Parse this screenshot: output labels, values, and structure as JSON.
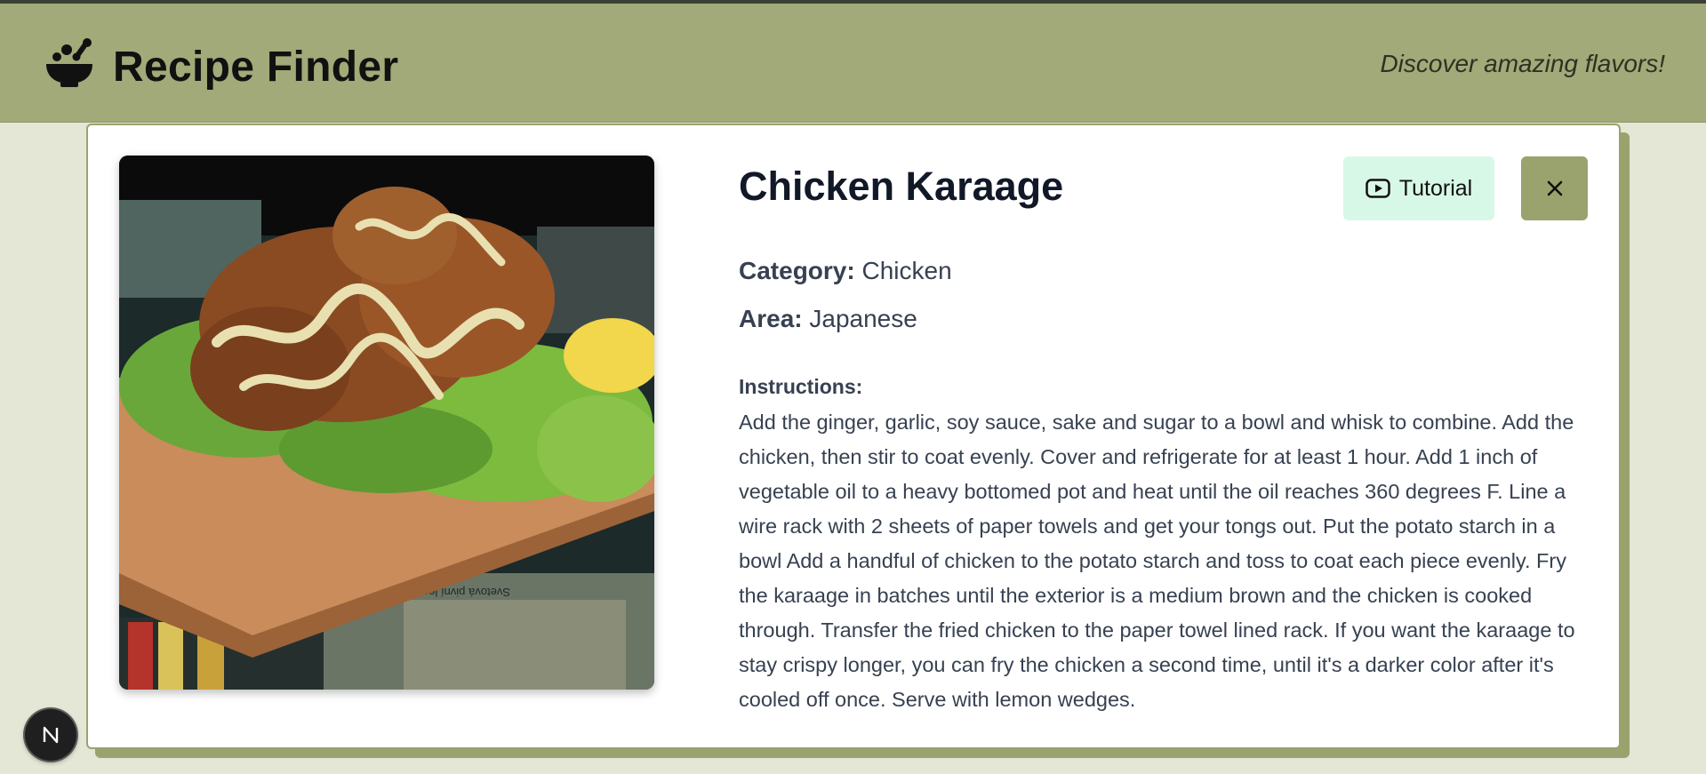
{
  "header": {
    "brand": "Recipe Finder",
    "tagline": "Discover amazing flavors!",
    "logo_icon": "mortar-bowl-icon",
    "background": "#a1aa78"
  },
  "recipe": {
    "title": "Chicken Karaage",
    "category_label": "Category:",
    "category": "Chicken",
    "area_label": "Area:",
    "area": "Japanese",
    "instructions_label": "Instructions:",
    "instructions": "Add the ginger, garlic, soy sauce, sake and sugar to a bowl and whisk to combine. Add the chicken, then stir to coat evenly. Cover and refrigerate for at least 1 hour. Add 1 inch of vegetable oil to a heavy bottomed pot and heat until the oil reaches 360 degrees F. Line a wire rack with 2 sheets of paper towels and get your tongs out. Put the potato starch in a bowl Add a handful of chicken to the potato starch and toss to coat each piece evenly. Fry the karaage in batches until the exterior is a medium brown and the chicken is cooked through. Transfer the fried chicken to the paper towel lined rack. If you want the karaage to stay crispy longer, you can fry the chicken a second time, until it's a darker color after it's cooled off once. Serve with lemon wedges.",
    "image_alt": "Chicken Karaage"
  },
  "actions": {
    "tutorial_label": "Tutorial",
    "tutorial_icon": "youtube-play-icon",
    "close_icon": "close-icon"
  },
  "photo_caption_text": "Svetová pivní legenda",
  "badge": {
    "letter": "N"
  },
  "colors": {
    "accent": "#9aa26e",
    "tutorial_bg": "#d8f8e7",
    "page_bg": "#e4e6d6",
    "title": "#111827",
    "body_text": "#374151"
  }
}
